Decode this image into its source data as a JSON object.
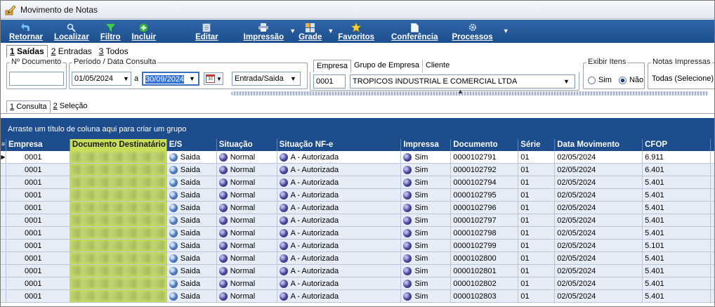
{
  "window": {
    "title": "Movimento de Notas",
    "icon": "app-pencil-icon"
  },
  "toolbar": {
    "buttons": [
      {
        "label": "Retornar",
        "icon": "back-arrow-icon"
      },
      {
        "label": "Localizar",
        "icon": "search-icon"
      },
      {
        "label": "Filtro",
        "icon": "filter-icon"
      },
      {
        "label": "Incluir",
        "icon": "plus-icon"
      },
      {
        "label": "Editar",
        "icon": "edit-icon"
      },
      {
        "label": "Impressão",
        "icon": "printer-icon"
      },
      {
        "label": "Grade",
        "icon": "grid-icon"
      },
      {
        "label": "Favoritos",
        "icon": "star-icon"
      },
      {
        "label": "Conferência",
        "icon": "document-icon"
      },
      {
        "label": "Processos",
        "icon": "gear-icon"
      }
    ]
  },
  "mode_tabs": [
    {
      "key": "1",
      "label": "Saídas"
    },
    {
      "key": "2",
      "label": "Entradas"
    },
    {
      "key": "3",
      "label": "Todos"
    }
  ],
  "filters": {
    "doc_number": {
      "legend": "Nº Documento",
      "value": ""
    },
    "period": {
      "legend": "Período / Data Consulta",
      "from": "01/05/2024",
      "sep": "a",
      "to": "30/09/2024",
      "type": "Entrada/Saida"
    },
    "empresa_tabs": [
      "Empresa",
      "Grupo de Empresa",
      "Cliente"
    ],
    "empresa": {
      "code": "0001",
      "name": "TROPICOS INDUSTRIAL E COMERCIAL LTDA"
    },
    "exibir_itens": {
      "legend": "Exibir Itens",
      "opt_yes": "Sim",
      "opt_no": "Não",
      "selected": "Não"
    },
    "notas_impressas": {
      "legend": "Notas Impressas",
      "value": "Todas (Selecione)"
    },
    "calendar_label": "30"
  },
  "sub_tabs": [
    {
      "key": "1",
      "label": "Consulta"
    },
    {
      "key": "2",
      "label": "Seleção"
    }
  ],
  "group_panel": {
    "text": "Arraste um título de coluna aqui para criar um grupo"
  },
  "grid": {
    "columns": [
      "Empresa",
      "Documento Destinatário",
      "E/S",
      "Situação",
      "Situação NF-e",
      "Impressa",
      "Documento",
      "Série",
      "Data Movimento",
      "CFOP"
    ],
    "rows": [
      {
        "empresa": "0001",
        "es": "Saida",
        "situacao": "Normal",
        "nfe": "A - Autorizada",
        "impressa": "Sim",
        "documento": "0000102791",
        "serie": "01",
        "data": "02/05/2024",
        "cfop": "6.911"
      },
      {
        "empresa": "0001",
        "es": "Saida",
        "situacao": "Normal",
        "nfe": "A - Autorizada",
        "impressa": "Sim",
        "documento": "0000102792",
        "serie": "01",
        "data": "02/05/2024",
        "cfop": "6.401"
      },
      {
        "empresa": "0001",
        "es": "Saida",
        "situacao": "Normal",
        "nfe": "A - Autorizada",
        "impressa": "Sim",
        "documento": "0000102794",
        "serie": "01",
        "data": "02/05/2024",
        "cfop": "5.401"
      },
      {
        "empresa": "0001",
        "es": "Saida",
        "situacao": "Normal",
        "nfe": "A - Autorizada",
        "impressa": "Sim",
        "documento": "0000102795",
        "serie": "01",
        "data": "02/05/2024",
        "cfop": "5.401"
      },
      {
        "empresa": "0001",
        "es": "Saida",
        "situacao": "Normal",
        "nfe": "A - Autorizada",
        "impressa": "Sim",
        "documento": "0000102796",
        "serie": "01",
        "data": "02/05/2024",
        "cfop": "5.401"
      },
      {
        "empresa": "0001",
        "es": "Saida",
        "situacao": "Normal",
        "nfe": "A - Autorizada",
        "impressa": "Sim",
        "documento": "0000102797",
        "serie": "01",
        "data": "02/05/2024",
        "cfop": "5.401"
      },
      {
        "empresa": "0001",
        "es": "Saida",
        "situacao": "Normal",
        "nfe": "A - Autorizada",
        "impressa": "Sim",
        "documento": "0000102798",
        "serie": "01",
        "data": "02/05/2024",
        "cfop": "5.401"
      },
      {
        "empresa": "0001",
        "es": "Saida",
        "situacao": "Normal",
        "nfe": "A - Autorizada",
        "impressa": "Sim",
        "documento": "0000102799",
        "serie": "01",
        "data": "02/05/2024",
        "cfop": "5.101"
      },
      {
        "empresa": "0001",
        "es": "Saida",
        "situacao": "Normal",
        "nfe": "A - Autorizada",
        "impressa": "Sim",
        "documento": "0000102800",
        "serie": "01",
        "data": "02/05/2024",
        "cfop": "5.401"
      },
      {
        "empresa": "0001",
        "es": "Saida",
        "situacao": "Normal",
        "nfe": "A - Autorizada",
        "impressa": "Sim",
        "documento": "0000102801",
        "serie": "01",
        "data": "02/05/2024",
        "cfop": "5.401"
      },
      {
        "empresa": "0001",
        "es": "Saida",
        "situacao": "Normal",
        "nfe": "A - Autorizada",
        "impressa": "Sim",
        "documento": "0000102802",
        "serie": "01",
        "data": "02/05/2024",
        "cfop": "5.401"
      },
      {
        "empresa": "0001",
        "es": "Saida",
        "situacao": "Normal",
        "nfe": "A - Autorizada",
        "impressa": "Sim",
        "documento": "0000102803",
        "serie": "01",
        "data": "02/05/2024",
        "cfop": "5.401"
      }
    ]
  },
  "colors": {
    "toolbar": "#1e4f8f",
    "grid_header": "#1d4d8c",
    "highlight_column": "#c8de5a",
    "row_bg": "#e6edf6"
  }
}
